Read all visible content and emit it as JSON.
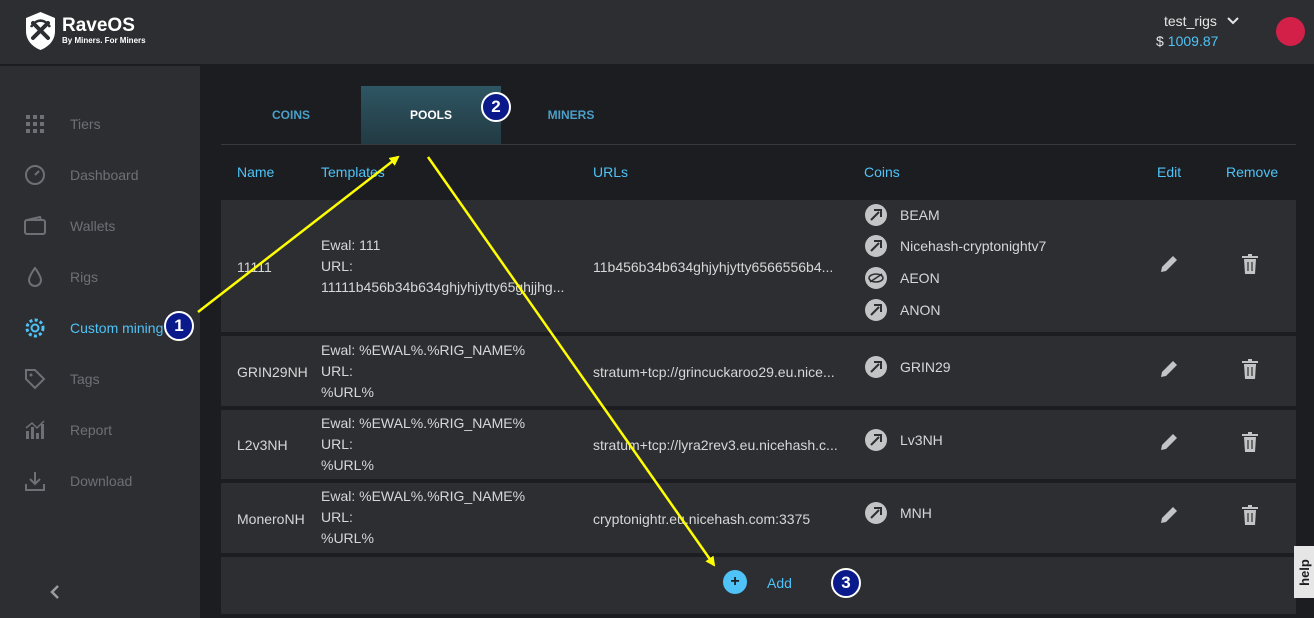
{
  "brand": {
    "name": "RaveOS",
    "tagline": "By Miners. For Miners"
  },
  "account": {
    "name": "test_rigs",
    "currency": "$",
    "balance": "1009.87"
  },
  "sidebar": {
    "items": [
      {
        "label": "Tiers",
        "icon": "grid-icon"
      },
      {
        "label": "Dashboard",
        "icon": "gauge-icon"
      },
      {
        "label": "Wallets",
        "icon": "wallet-icon"
      },
      {
        "label": "Rigs",
        "icon": "drop-icon"
      },
      {
        "label": "Custom mining",
        "icon": "gear-icon",
        "active": true
      },
      {
        "label": "Tags",
        "icon": "tag-icon"
      },
      {
        "label": "Report",
        "icon": "chart-icon"
      },
      {
        "label": "Download",
        "icon": "download-icon"
      }
    ]
  },
  "tabs": [
    {
      "label": "COINS"
    },
    {
      "label": "POOLS",
      "active": true
    },
    {
      "label": "MINERS"
    }
  ],
  "table": {
    "headers": {
      "name": "Name",
      "templates": "Templates",
      "urls": "URLs",
      "coins": "Coins",
      "edit": "Edit",
      "remove": "Remove"
    },
    "rows": [
      {
        "name": "11111",
        "template_lines": [
          "Ewal: 111",
          "URL:",
          "11111b456b34b634ghjyhjytty65ghjjhg..."
        ],
        "url": "11b456b34b634ghjyhjytty6566556b4...",
        "coins": [
          {
            "name": "BEAM",
            "icon": "pickaxe-icon"
          },
          {
            "name": "Nicehash-cryptonightv7",
            "icon": "pickaxe-icon"
          },
          {
            "name": "AEON",
            "icon": "aeon-icon"
          },
          {
            "name": "ANON",
            "icon": "pickaxe-icon"
          }
        ]
      },
      {
        "name": "GRIN29NH",
        "template_lines": [
          "Ewal: %EWAL%.%RIG_NAME%",
          "URL:",
          "%URL%"
        ],
        "url": "stratum+tcp://grincuckaroo29.eu.nice...",
        "coins": [
          {
            "name": "GRIN29",
            "icon": "pickaxe-icon"
          }
        ]
      },
      {
        "name": "L2v3NH",
        "template_lines": [
          "Ewal: %EWAL%.%RIG_NAME%",
          "URL:",
          "%URL%"
        ],
        "url": "stratum+tcp://lyra2rev3.eu.nicehash.c...",
        "coins": [
          {
            "name": "Lv3NH",
            "icon": "pickaxe-icon"
          }
        ]
      },
      {
        "name": "MoneroNH",
        "template_lines": [
          "Ewal: %EWAL%.%RIG_NAME%",
          "URL:",
          "%URL%"
        ],
        "url": "cryptonightr.eu.nicehash.com:3375",
        "coins": [
          {
            "name": "MNH",
            "icon": "pickaxe-icon"
          }
        ]
      }
    ]
  },
  "add": {
    "label": "Add",
    "icon": "plus-icon"
  },
  "help": {
    "label": "help"
  },
  "annotations": [
    {
      "label": "1"
    },
    {
      "label": "2"
    },
    {
      "label": "3"
    }
  ],
  "colors": {
    "accent": "#4fc3f7",
    "panel": "#2d2e31",
    "background": "#1c1d20",
    "avatar": "#d32049",
    "annotation_arrow": "#ffff00",
    "annotation_marker": "#0a1a8a"
  }
}
